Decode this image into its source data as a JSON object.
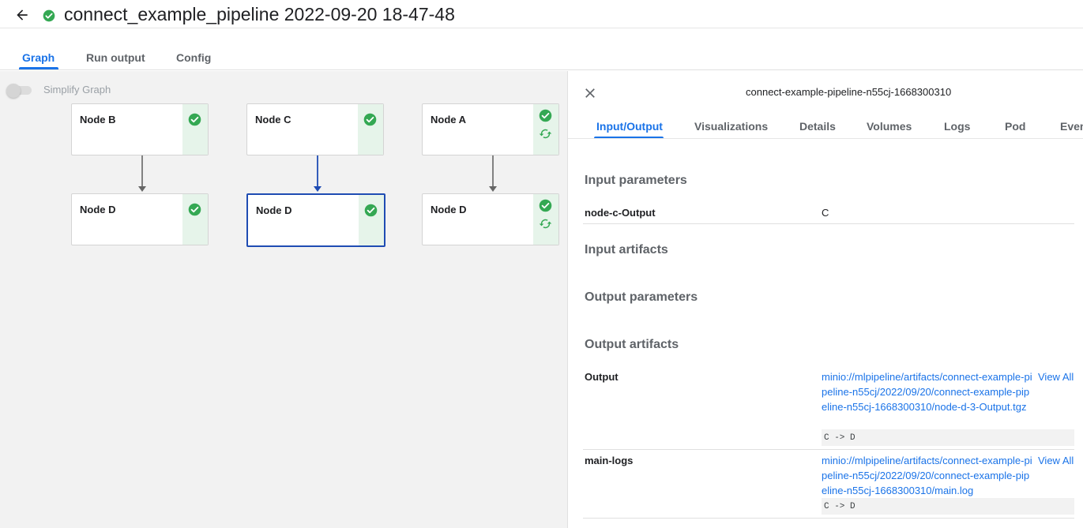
{
  "header": {
    "title": "connect_example_pipeline 2022-09-20 18-47-48",
    "status_color": "#34a853"
  },
  "main_tabs": [
    {
      "label": "Graph",
      "active": true
    },
    {
      "label": "Run output",
      "active": false
    },
    {
      "label": "Config",
      "active": false
    }
  ],
  "graph": {
    "simplify_label": "Simplify Graph",
    "simplify_enabled": false,
    "nodes": [
      {
        "label": "Node B",
        "status": [
          "success"
        ]
      },
      {
        "label": "Node C",
        "status": [
          "success"
        ]
      },
      {
        "label": "Node A",
        "status": [
          "success",
          "cached"
        ]
      },
      {
        "label": "Node D",
        "status": [
          "success"
        ]
      },
      {
        "label": "Node D",
        "status": [
          "success"
        ],
        "selected": true
      },
      {
        "label": "Node D",
        "status": [
          "success",
          "cached"
        ]
      }
    ],
    "edge_color": "#666666",
    "selected_color": "#1f4cb3",
    "success_bg": "#e6f4ea"
  },
  "panel": {
    "title": "connect-example-pipeline-n55cj-1668300310",
    "tabs": [
      {
        "label": "Input/Output",
        "active": true
      },
      {
        "label": "Visualizations"
      },
      {
        "label": "Details"
      },
      {
        "label": "Volumes"
      },
      {
        "label": "Logs"
      },
      {
        "label": "Pod"
      },
      {
        "label": "Events"
      }
    ],
    "sections": {
      "input_parameters": "Input parameters",
      "input_artifacts": "Input artifacts",
      "output_parameters": "Output parameters",
      "output_artifacts": "Output artifacts"
    },
    "input_params": [
      {
        "key": "node-c-Output",
        "value": "C"
      }
    ],
    "output_artifacts": [
      {
        "key": "Output",
        "uri": "minio://mlpipeline/artifacts/connect-example-pipeline-n55cj/2022/09/20/connect-example-pipeline-n55cj-1668300310/node-d-3-Output.tgz",
        "view_all": "View All",
        "preview": "C -> D"
      },
      {
        "key": "main-logs",
        "uri": "minio://mlpipeline/artifacts/connect-example-pipeline-n55cj/2022/09/20/connect-example-pipeline-n55cj-1668300310/main.log",
        "view_all": "View All",
        "preview": "C -> D"
      }
    ]
  }
}
